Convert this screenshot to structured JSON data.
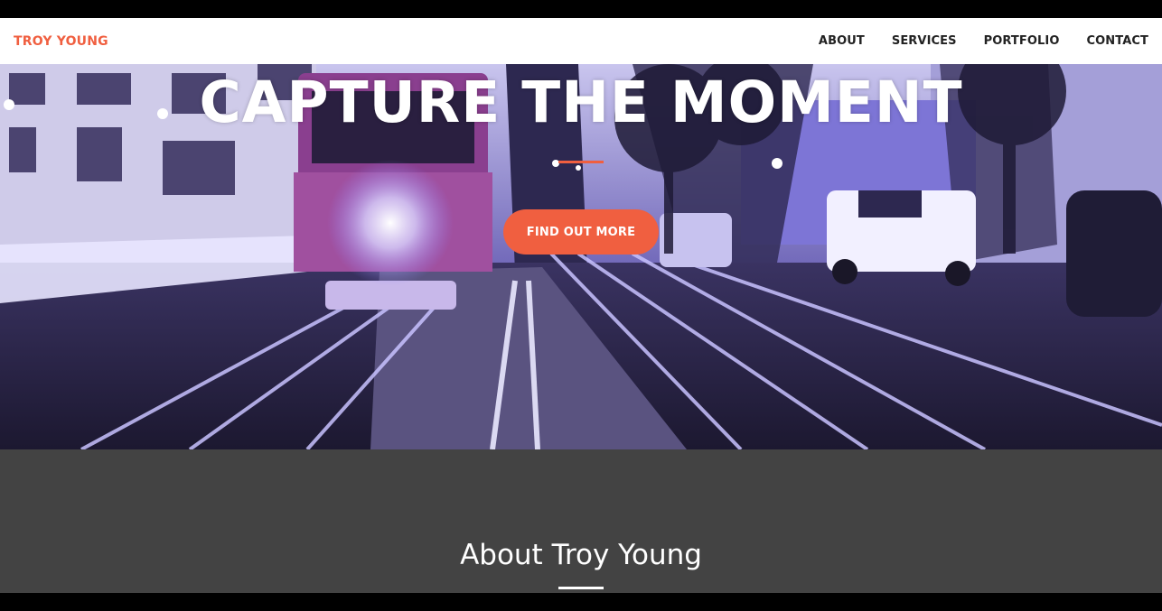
{
  "navbar": {
    "brand": "TROY YOUNG",
    "links": [
      "ABOUT",
      "SERVICES",
      "PORTFOLIO",
      "CONTACT"
    ]
  },
  "hero": {
    "title": "CAPTURE THE MOMENT",
    "button_label": "FIND OUT MORE",
    "image_description_icon": "night-street-cable-car-photo"
  },
  "about": {
    "heading": "About Troy Young"
  },
  "colors": {
    "accent": "#f05f40",
    "section_bg": "#434343",
    "nav_bg": "#ffffff"
  }
}
